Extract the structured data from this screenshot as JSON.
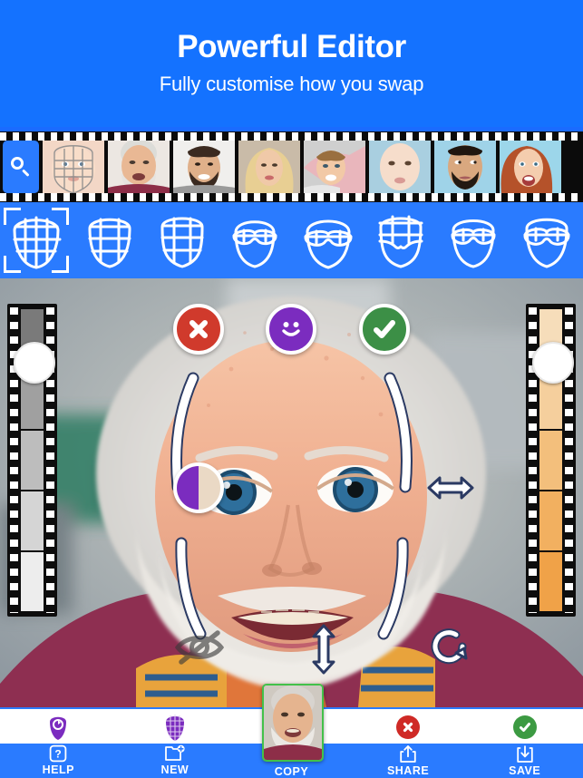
{
  "header": {
    "title": "Powerful Editor",
    "subtitle": "Fully customise how you swap",
    "bg_color": "#1472ff"
  },
  "thumbstrip": {
    "search_icon": "search-icon",
    "items": [
      {
        "name": "thumb-baby-grid",
        "label": "Baby with mesh grid"
      },
      {
        "name": "thumb-elder-man",
        "label": "Elderly man white beard"
      },
      {
        "name": "thumb-bearded-man",
        "label": "Young bearded man"
      },
      {
        "name": "thumb-blonde-woman",
        "label": "Blonde woman"
      },
      {
        "name": "thumb-boy",
        "label": "Smiling boy"
      },
      {
        "name": "thumb-toddler",
        "label": "Toddler"
      },
      {
        "name": "thumb-man-grimace",
        "label": "Man grimacing"
      },
      {
        "name": "thumb-redhead-woman",
        "label": "Redhead woman surprised"
      }
    ]
  },
  "mask_shapes": {
    "selected_index": 0,
    "items": [
      {
        "name": "mask-full-grid-wide",
        "type": "full",
        "rows": 4,
        "cols": 4
      },
      {
        "name": "mask-full-grid-square",
        "type": "full",
        "rows": 4,
        "cols": 3
      },
      {
        "name": "mask-full-grid-tall",
        "type": "full",
        "rows": 4,
        "cols": 3
      },
      {
        "name": "mask-eyes-narrow",
        "type": "eyes",
        "rows": 2,
        "cols": 4
      },
      {
        "name": "mask-eyes-wide",
        "type": "eyes",
        "rows": 2,
        "cols": 4
      },
      {
        "name": "mask-upper-half",
        "type": "upper",
        "rows": 3,
        "cols": 3
      },
      {
        "name": "mask-eyes-oval",
        "type": "eyes",
        "rows": 2,
        "cols": 4
      },
      {
        "name": "mask-eyes-tall",
        "type": "eyes",
        "rows": 2,
        "cols": 4
      }
    ]
  },
  "editor": {
    "photo_alt": "Swapped face: baby features on elderly man",
    "controls": {
      "cancel": {
        "name": "cancel-button",
        "icon": "x-icon",
        "color": "#d03a2c"
      },
      "smiley": {
        "name": "smiley-button",
        "icon": "smiley-icon",
        "color": "#7b2cbf"
      },
      "confirm": {
        "name": "confirm-button",
        "icon": "check-icon",
        "color": "#3c8f46"
      },
      "opacity": {
        "name": "opacity-button",
        "icon": "half-circle-icon",
        "color": "#7b2cbf"
      },
      "resize_horizontal": {
        "name": "resize-horizontal-handle",
        "icon": "arrows-left-right-icon"
      },
      "resize_vertical": {
        "name": "resize-vertical-handle",
        "icon": "arrows-up-down-icon"
      },
      "hide": {
        "name": "hide-button",
        "icon": "eye-off-icon"
      },
      "rotate": {
        "name": "rotate-button",
        "icon": "rotate-icon"
      }
    },
    "left_slider": {
      "name": "brightness-slider",
      "knob_position_percent": 12,
      "colors": [
        "#7a7a7a",
        "#a0a0a0",
        "#bdbdbd",
        "#d5d5d5",
        "#ededed"
      ]
    },
    "right_slider": {
      "name": "skintone-slider",
      "knob_position_percent": 12,
      "colors": [
        "#f6ddba",
        "#f5cf9d",
        "#f3bf7c",
        "#f2b060",
        "#f0a248"
      ]
    }
  },
  "toolbar": {
    "top_icons": [
      {
        "name": "face-shape-icon-help",
        "color": "#7b2cbf"
      },
      {
        "name": "face-mesh-icon-new",
        "color": "#7b2cbf"
      },
      {
        "name": "copy-thumbnail",
        "color": "#43c14a"
      },
      {
        "name": "discard-icon-share",
        "color": "#cf2a26"
      },
      {
        "name": "accept-icon-save",
        "color": "#3c9a42"
      }
    ],
    "buttons": [
      {
        "name": "help-button",
        "label": "HELP",
        "icon": "question-box-icon"
      },
      {
        "name": "new-button",
        "label": "NEW",
        "icon": "folder-plus-icon"
      },
      {
        "name": "copy-button",
        "label": "COPY",
        "icon": "face-thumbnail"
      },
      {
        "name": "share-button",
        "label": "SHARE",
        "icon": "share-upload-icon"
      },
      {
        "name": "save-button",
        "label": "SAVE",
        "icon": "save-download-icon"
      }
    ]
  },
  "colors": {
    "brand_blue": "#2a7bff",
    "header_blue": "#1472ff",
    "accent_green": "#43c14a",
    "accent_red": "#cf2a26",
    "accent_purple": "#7b2cbf"
  }
}
